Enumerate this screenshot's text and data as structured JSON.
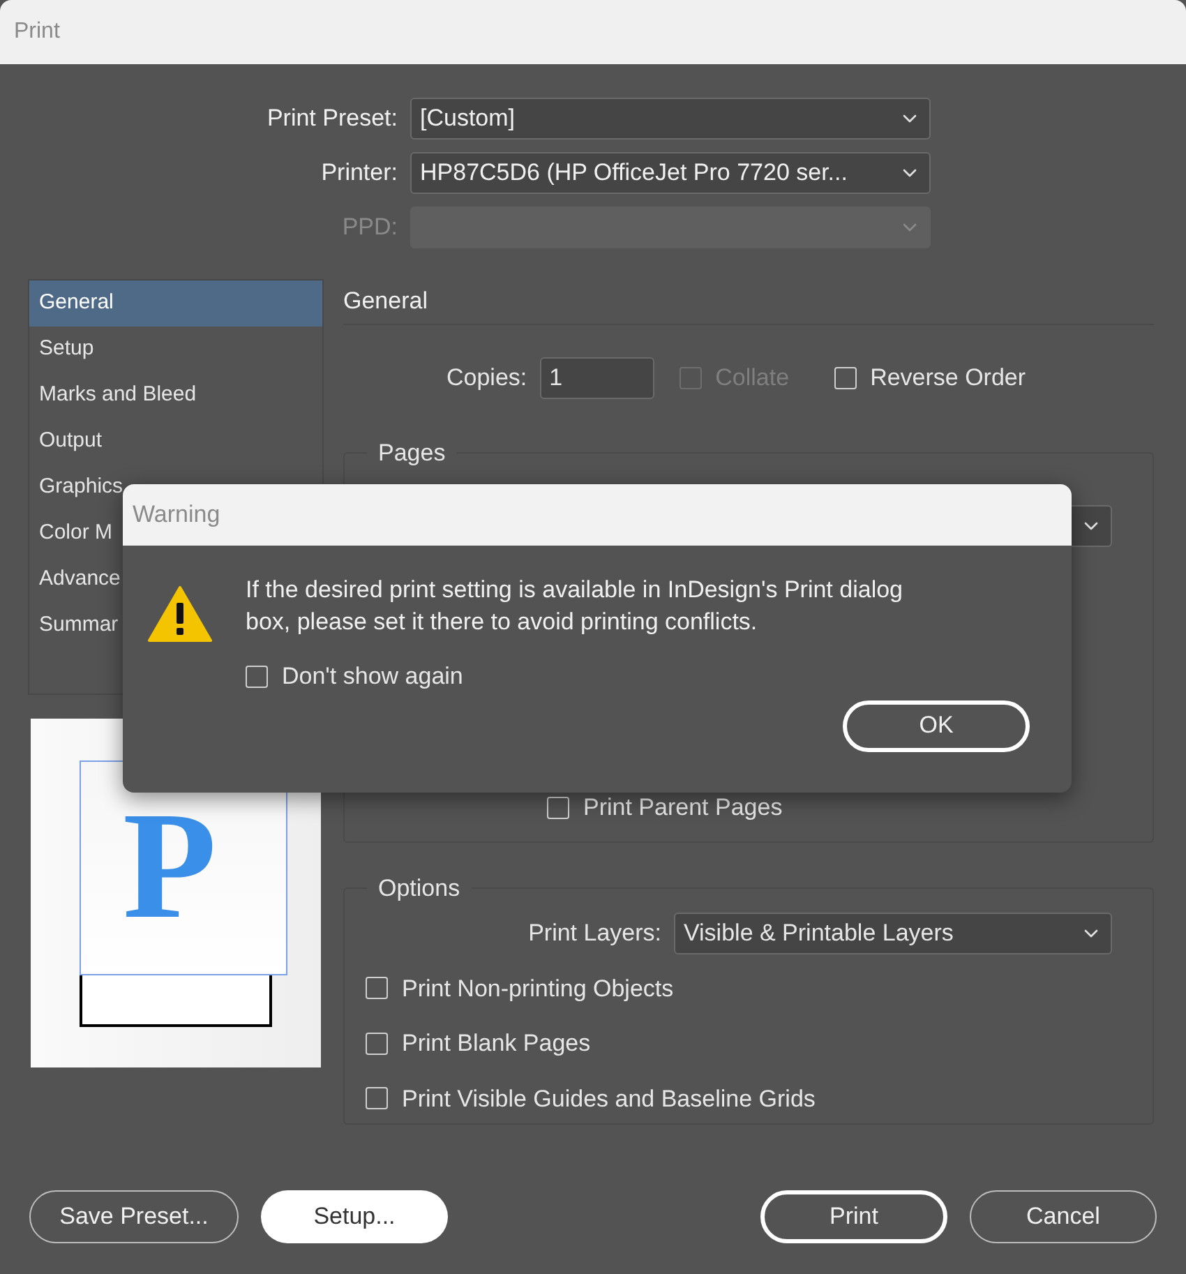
{
  "window": {
    "title": "Print"
  },
  "fields": [
    {
      "label": "Print Preset:",
      "value": "[Custom]",
      "disabled": false
    },
    {
      "label": "Printer:",
      "value": "HP87C5D6 (HP OfficeJet Pro 7720 ser...",
      "disabled": false
    },
    {
      "label": "PPD:",
      "disabled": true
    }
  ],
  "sidebar": {
    "items": [
      {
        "label": "General",
        "selected": true
      },
      {
        "label": "Setup",
        "selected": false
      },
      {
        "label": "Marks and Bleed",
        "selected": false
      },
      {
        "label": "Output",
        "selected": false
      },
      {
        "label": "Graphics",
        "selected": false
      },
      {
        "label": "Color M",
        "selected": false
      },
      {
        "label": "Advance",
        "selected": false
      },
      {
        "label": "Summar",
        "selected": false
      }
    ]
  },
  "preview": {
    "glyph": "P"
  },
  "section": {
    "title": "General"
  },
  "copies": {
    "label": "Copies:",
    "value": "1"
  },
  "collate": {
    "label": "Collate",
    "checked": false,
    "disabled": true
  },
  "reverse_order": {
    "label": "Reverse Order",
    "checked": false
  },
  "pages": {
    "title": "Pages",
    "print_parent_pages": {
      "label": "Print Parent Pages",
      "checked": false
    }
  },
  "options": {
    "title": "Options",
    "print_layers": {
      "label": "Print Layers:",
      "value": "Visible & Printable Layers"
    },
    "checkboxes": [
      {
        "label": "Print Non-printing Objects",
        "checked": false
      },
      {
        "label": "Print Blank Pages",
        "checked": false
      },
      {
        "label": "Print Visible Guides and Baseline Grids",
        "checked": false
      }
    ]
  },
  "buttons": [
    {
      "label": "Save Preset...",
      "kind": "outline"
    },
    {
      "label": "Setup...",
      "kind": "filled"
    },
    {
      "label": "Print",
      "kind": "default"
    },
    {
      "label": "Cancel",
      "kind": "outline"
    }
  ],
  "warning": {
    "title": "Warning",
    "message": "If the desired print setting is available in InDesign's Print dialog box, please set it there to avoid printing conflicts.",
    "dont_show_again": {
      "label": "Don't show again",
      "checked": false
    },
    "button": "OK"
  }
}
